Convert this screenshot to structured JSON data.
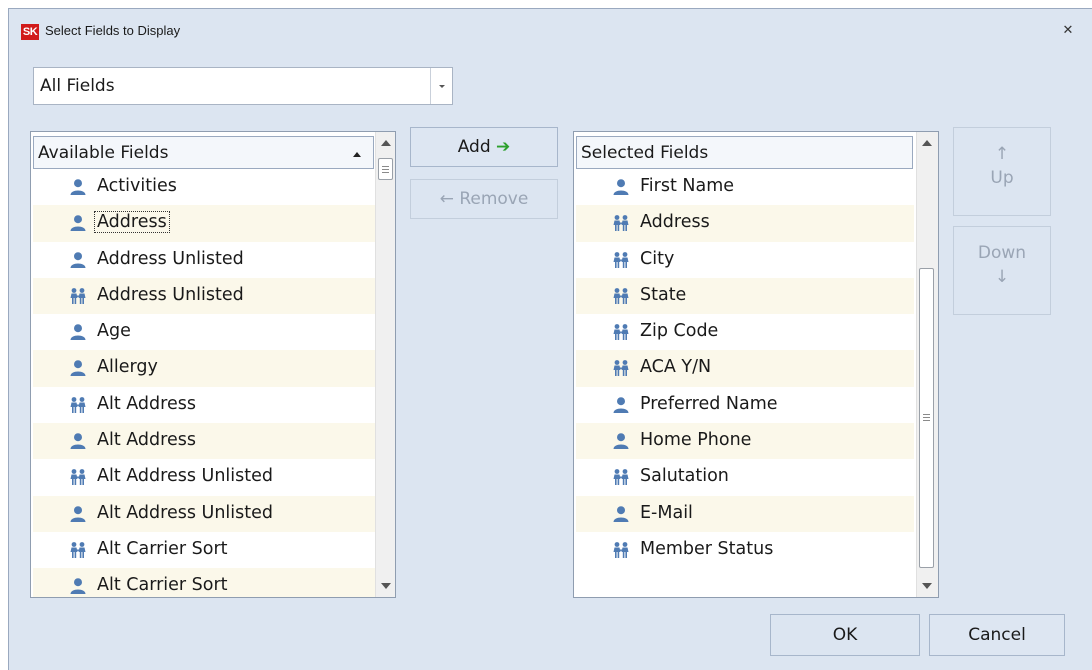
{
  "window": {
    "logo": "SK",
    "title": "Select Fields to Display",
    "close_glyph": "✕"
  },
  "filter": {
    "value": "All Fields"
  },
  "available": {
    "header": "Available Fields",
    "rows": [
      {
        "icon": "person",
        "label": "Activities"
      },
      {
        "icon": "person",
        "label": "Address"
      },
      {
        "icon": "person",
        "label": "Address Unlisted"
      },
      {
        "icon": "family",
        "label": "Address Unlisted"
      },
      {
        "icon": "person",
        "label": "Age"
      },
      {
        "icon": "person",
        "label": "Allergy"
      },
      {
        "icon": "family",
        "label": "Alt Address"
      },
      {
        "icon": "person",
        "label": "Alt Address"
      },
      {
        "icon": "family",
        "label": "Alt Address Unlisted"
      },
      {
        "icon": "person",
        "label": "Alt Address Unlisted"
      },
      {
        "icon": "family",
        "label": "Alt Carrier Sort"
      },
      {
        "icon": "person",
        "label": "Alt Carrier Sort"
      }
    ]
  },
  "selected": {
    "header": "Selected Fields",
    "rows": [
      {
        "icon": "person",
        "label": "First Name"
      },
      {
        "icon": "family",
        "label": "Address"
      },
      {
        "icon": "family",
        "label": "City"
      },
      {
        "icon": "family",
        "label": "State"
      },
      {
        "icon": "family",
        "label": "Zip Code"
      },
      {
        "icon": "family",
        "label": "ACA Y/N"
      },
      {
        "icon": "person",
        "label": "Preferred Name"
      },
      {
        "icon": "person",
        "label": "Home Phone"
      },
      {
        "icon": "family",
        "label": "Salutation"
      },
      {
        "icon": "person",
        "label": "E-Mail"
      },
      {
        "icon": "family",
        "label": "Member Status"
      }
    ]
  },
  "buttons": {
    "add": "Add",
    "add_arrow": "➔",
    "remove": "Remove",
    "remove_arrow": "←",
    "up": "Up",
    "up_arrow": "↑",
    "down": "Down",
    "down_arrow": "↓",
    "ok": "OK",
    "cancel": "Cancel"
  },
  "colors": {
    "person_icon": "#4f7bb3",
    "family_icon": "#4f7bb3",
    "add_arrow": "#2ca02c",
    "logo_bg": "#d11a1a"
  }
}
